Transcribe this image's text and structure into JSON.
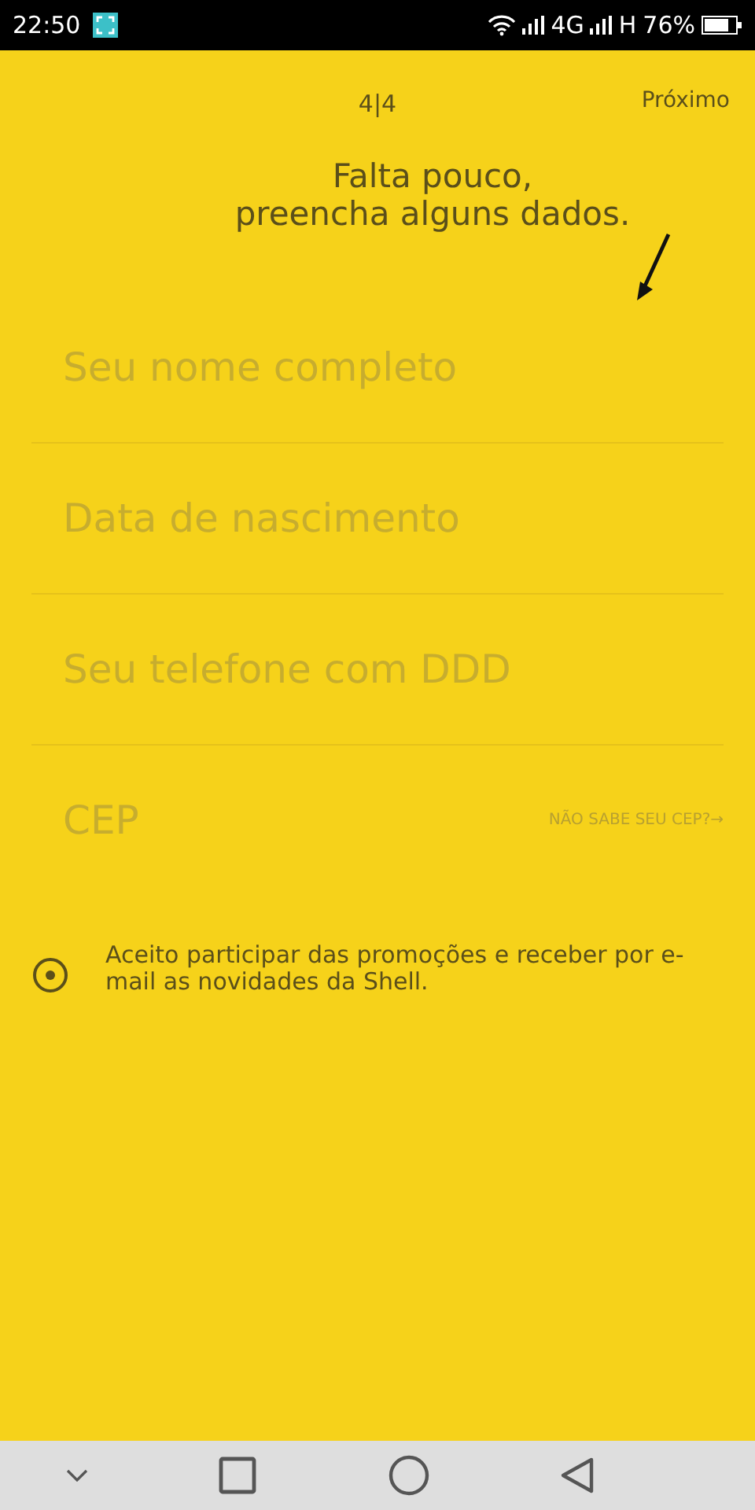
{
  "status_bar": {
    "time": "22:50",
    "network_1": "4G",
    "network_2": "H",
    "battery": "76%"
  },
  "header": {
    "step": "4|4",
    "next": "Próximo"
  },
  "title": [
    "Falta pouco,",
    "preencha alguns dados."
  ],
  "fields": [
    {
      "placeholder": "Seu nome completo"
    },
    {
      "placeholder": "Data de nascimento"
    },
    {
      "placeholder": "Seu telefone com DDD"
    },
    {
      "placeholder": "CEP",
      "link": "NÃO SABE SEU CEP?→"
    }
  ],
  "consent": {
    "text": "Aceito participar das promoções e receber por e-mail as novidades da Shell.",
    "selected": true
  }
}
